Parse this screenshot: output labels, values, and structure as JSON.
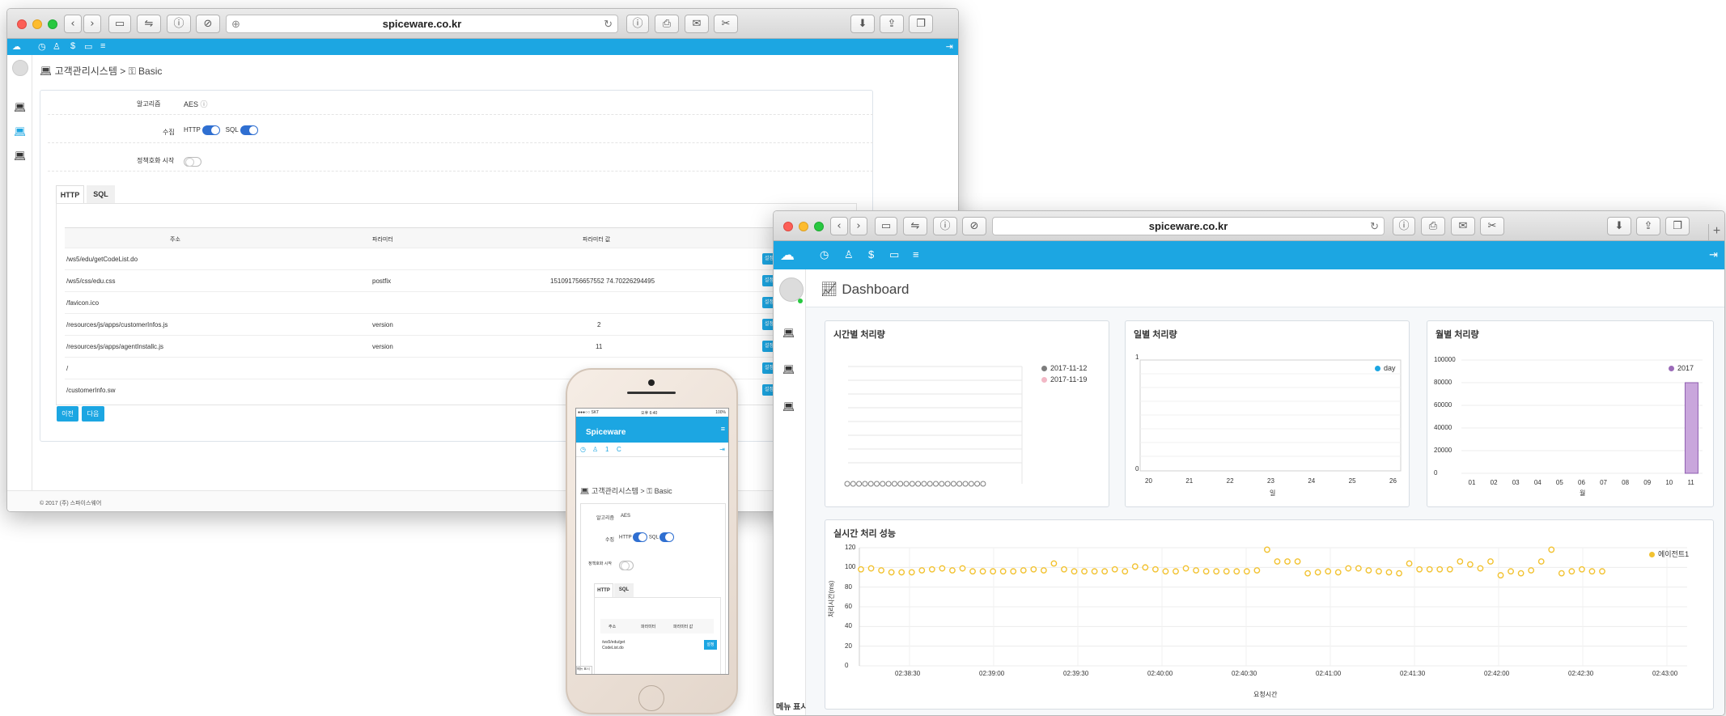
{
  "admin_window": {
    "url": "spiceware.co.kr",
    "breadcrumb": "고객관리시스템",
    "breadcrumb_sep": ">",
    "breadcrumb_page": "Basic",
    "algo_label": "알고리즘",
    "algo_value": "AES",
    "collect_label": "수집",
    "http_label": "HTTP",
    "sql_label": "SQL",
    "policy_label": "정책호화 시작",
    "tabs": [
      "HTTP",
      "SQL"
    ],
    "table_headers": [
      "주소",
      "파라미터",
      "파라미터 값"
    ],
    "table_rows": [
      {
        "address": "/ws5/edu/getCodeList.do",
        "param": "",
        "value": ""
      },
      {
        "address": "/ws5/css/edu.css",
        "param": "postfix",
        "value": "151091756657552 74.70226294495"
      },
      {
        "address": "/favicon.ico",
        "param": "",
        "value": ""
      },
      {
        "address": "/resources/js/apps/customerInfos.js",
        "param": "version",
        "value": "2"
      },
      {
        "address": "/resources/js/apps/agentInstallc.js",
        "param": "version",
        "value": "11"
      },
      {
        "address": "/",
        "param": "",
        "value": ""
      },
      {
        "address": "/customerInfo.sw",
        "param": "",
        "value": ""
      }
    ],
    "row_button": "설정",
    "prev_button": "이전",
    "next_button": "다음",
    "footer": "© 2017 (주) 스파이스웨어"
  },
  "dashboard_window": {
    "url": "spiceware.co.kr",
    "page_title": "Dashboard",
    "menu_label": "메뉴 표시",
    "accent": "#1ca6e2"
  },
  "phone": {
    "status_left": "●●●○○ SKT",
    "status_time": "오후 6:40",
    "status_right": "100%",
    "brand": "Spiceware",
    "breadcrumb": "고객관리시스템",
    "breadcrumb_page": "Basic",
    "algo_label": "알고리즘",
    "algo_value": "AES",
    "collect_label": "수집",
    "http_label": "HTTP",
    "sql_label": "SQL",
    "policy_label": "정책호화 시작",
    "tabs": [
      "HTTP",
      "SQL"
    ],
    "table_headers": [
      "주소",
      "파라미터",
      "파라미터 값"
    ],
    "row_address": "/ws5/edu/get CodeList.do",
    "row_button": "설정",
    "menu_label": "메뉴 표시"
  },
  "chart_data": [
    {
      "type": "scatter",
      "title": "시간별 처리량",
      "series": [
        {
          "name": "2017-11-12",
          "color": "#7d7d7d",
          "values": [
            0,
            0,
            0,
            0,
            0,
            0,
            0,
            0,
            0,
            0,
            0,
            0,
            0,
            0,
            0,
            0,
            0,
            0,
            0,
            0,
            0,
            0,
            0,
            0
          ]
        },
        {
          "name": "2017-11-19",
          "color": "#f2b8c6",
          "values": []
        }
      ]
    },
    {
      "type": "line",
      "title": "일별 처리량",
      "categories": [
        "20",
        "21",
        "22",
        "23",
        "24",
        "25",
        "26"
      ],
      "xlabel": "일",
      "ylim": [
        0,
        1
      ],
      "yticks": [
        "1",
        "0"
      ],
      "series": [
        {
          "name": "day",
          "color": "#1ca6e2",
          "values": [
            0,
            0,
            0,
            0,
            0,
            0,
            0
          ]
        }
      ]
    },
    {
      "type": "bar",
      "title": "월별 처리량",
      "categories": [
        "01",
        "02",
        "03",
        "04",
        "05",
        "06",
        "07",
        "08",
        "09",
        "10",
        "11"
      ],
      "xlabel": "월",
      "ylim": [
        0,
        100000
      ],
      "yticks": [
        "100000",
        "80000",
        "60000",
        "40000",
        "20000",
        "0"
      ],
      "series": [
        {
          "name": "2017",
          "color": "#c9a6dc",
          "values": [
            0,
            0,
            0,
            0,
            0,
            0,
            0,
            0,
            0,
            0,
            80000
          ]
        }
      ]
    },
    {
      "type": "scatter",
      "title": "실시간 처리 성능",
      "xlabel": "요청시간",
      "ylabel": "처리시간(ms)",
      "ylim": [
        0,
        120
      ],
      "yticks": [
        "120",
        "100",
        "80",
        "60",
        "40",
        "20",
        "0"
      ],
      "xticks": [
        "02:38:30",
        "02:39:00",
        "02:39:30",
        "02:40:00",
        "02:40:30",
        "02:41:00",
        "02:41:30",
        "02:42:00",
        "02:42:30",
        "02:43:00"
      ],
      "series": [
        {
          "name": "에이전트1",
          "color": "#f2c230",
          "values": [
            98,
            99,
            97,
            95,
            95,
            95,
            97,
            98,
            99,
            97,
            99,
            96,
            96,
            96,
            96,
            96,
            97,
            98,
            97,
            104,
            98,
            96,
            96,
            96,
            96,
            98,
            96,
            101,
            100,
            98,
            96,
            96,
            99,
            97,
            96,
            96,
            96,
            96,
            96,
            97,
            118,
            106,
            106,
            106,
            94,
            95,
            96,
            95,
            99,
            99,
            97,
            96,
            95,
            94,
            104,
            98,
            98,
            98,
            98,
            106,
            103,
            99,
            106,
            92,
            96,
            94,
            97,
            106,
            118,
            94,
            96,
            98,
            96,
            96
          ]
        }
      ]
    }
  ]
}
